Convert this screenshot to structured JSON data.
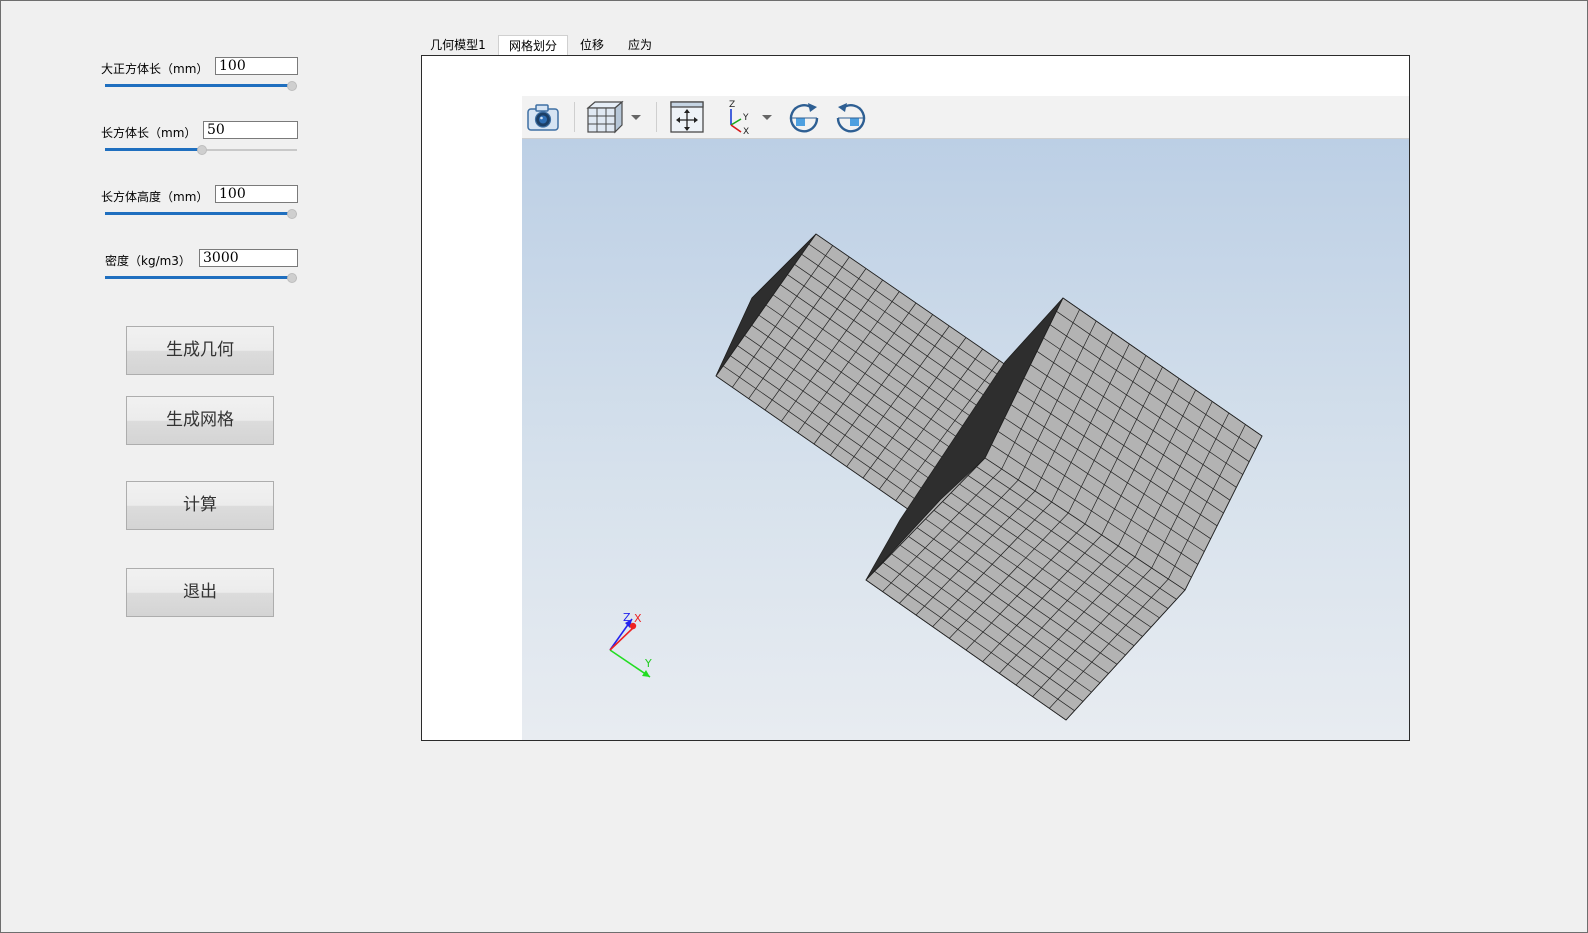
{
  "params": [
    {
      "label": "大正方体长（mm）",
      "value": "100",
      "slider_fraction": 1.0
    },
    {
      "label": "长方体长（mm）",
      "value": "50",
      "slider_fraction": 0.5
    },
    {
      "label": "长方体高度（mm）",
      "value": "100",
      "slider_fraction": 1.0
    },
    {
      "label": "密度（kg/m3）",
      "value": "3000",
      "slider_fraction": 1.0
    }
  ],
  "buttons": {
    "generate_geometry": "生成几何",
    "generate_mesh": "生成网格",
    "compute": "计算",
    "exit": "退出"
  },
  "tabs": [
    {
      "label": "几何模型1",
      "active": false
    },
    {
      "label": "网格划分",
      "active": true
    },
    {
      "label": "位移",
      "active": false
    },
    {
      "label": "应为",
      "active": false
    }
  ],
  "toolbar_icons": [
    "camera-icon",
    "cube-view-icon",
    "fit-view-icon",
    "axes-icon",
    "rotate-cw-icon",
    "rotate-ccw-icon"
  ],
  "triad": {
    "x_label": "X",
    "y_label": "Y",
    "z_label": "Z",
    "x_color": "#ff0000",
    "y_color": "#00cc00",
    "z_color": "#0000ff"
  },
  "colors": {
    "accent": "#1f6fbf",
    "mesh_face": "#b3b3b3",
    "mesh_dark": "#2e2e2e"
  }
}
